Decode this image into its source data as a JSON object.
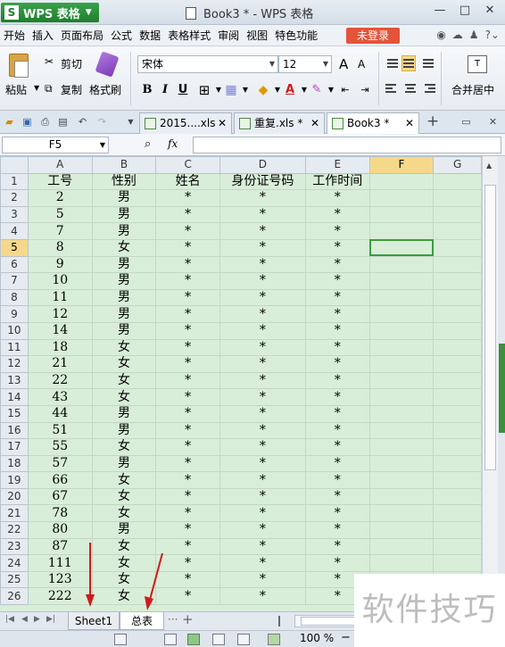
{
  "app": {
    "name": "WPS 表格",
    "window_title": "Book3 * - WPS 表格",
    "logo_letter": "S"
  },
  "window_controls": [
    "—",
    "□",
    "✕"
  ],
  "menu": {
    "items": [
      "开始",
      "插入",
      "页面布局",
      "公式",
      "数据",
      "表格样式",
      "审阅",
      "视图",
      "特色功能"
    ],
    "login_label": "未登录"
  },
  "ribbon": {
    "paste_label": "粘贴",
    "cut_label": "剪切",
    "copy_label": "复制",
    "format_painter_label": "格式刷",
    "font_name": "宋体",
    "font_size": "12",
    "bold": "B",
    "italic": "I",
    "underline": "U",
    "merge_label": "合并居中",
    "grow_font": "A",
    "shrink_font": "A"
  },
  "doc_tabs": [
    {
      "label": "2015....xls"
    },
    {
      "label": "重复.xls *"
    },
    {
      "label": "Book3 *"
    }
  ],
  "formula_bar": {
    "cell_ref": "F5",
    "fx_label": "fx",
    "value": ""
  },
  "grid": {
    "columns": [
      "A",
      "B",
      "C",
      "D",
      "E",
      "F",
      "G"
    ],
    "selected_column": "F",
    "selected_row": "5",
    "row_numbers": [
      "1",
      "2",
      "3",
      "4",
      "5",
      "6",
      "7",
      "8",
      "9",
      "10",
      "11",
      "12",
      "13",
      "14",
      "15",
      "16",
      "17",
      "18",
      "19",
      "20",
      "21",
      "22",
      "23",
      "24",
      "25",
      "26"
    ],
    "header_row": [
      "工号",
      "性别",
      "姓名",
      "身份证号码",
      "工作时间"
    ],
    "rows": [
      [
        "2",
        "男",
        "*",
        "*",
        "*"
      ],
      [
        "5",
        "男",
        "*",
        "*",
        "*"
      ],
      [
        "7",
        "男",
        "*",
        "*",
        "*"
      ],
      [
        "8",
        "女",
        "*",
        "*",
        "*"
      ],
      [
        "9",
        "男",
        "*",
        "*",
        "*"
      ],
      [
        "10",
        "男",
        "*",
        "*",
        "*"
      ],
      [
        "11",
        "男",
        "*",
        "*",
        "*"
      ],
      [
        "12",
        "男",
        "*",
        "*",
        "*"
      ],
      [
        "14",
        "男",
        "*",
        "*",
        "*"
      ],
      [
        "18",
        "女",
        "*",
        "*",
        "*"
      ],
      [
        "21",
        "女",
        "*",
        "*",
        "*"
      ],
      [
        "22",
        "女",
        "*",
        "*",
        "*"
      ],
      [
        "43",
        "女",
        "*",
        "*",
        "*"
      ],
      [
        "44",
        "男",
        "*",
        "*",
        "*"
      ],
      [
        "51",
        "男",
        "*",
        "*",
        "*"
      ],
      [
        "55",
        "女",
        "*",
        "*",
        "*"
      ],
      [
        "57",
        "男",
        "*",
        "*",
        "*"
      ],
      [
        "66",
        "女",
        "*",
        "*",
        "*"
      ],
      [
        "67",
        "女",
        "*",
        "*",
        "*"
      ],
      [
        "78",
        "女",
        "*",
        "*",
        "*"
      ],
      [
        "80",
        "男",
        "*",
        "*",
        "*"
      ],
      [
        "87",
        "女",
        "*",
        "*",
        "*"
      ],
      [
        "111",
        "女",
        "*",
        "*",
        "*"
      ],
      [
        "123",
        "女",
        "*",
        "*",
        "*"
      ],
      [
        "222",
        "女",
        "*",
        "*",
        "*"
      ]
    ]
  },
  "sheet_tabs": [
    "Sheet1",
    "总表"
  ],
  "active_sheet": "总表",
  "status": {
    "zoom": "100 %"
  },
  "watermark": "软件技巧",
  "colors": {
    "cell_fill": "#d8eed8",
    "selection": "#3d9b3d",
    "app_button": "#1f7e2d",
    "login": "#e4533a",
    "annotation_arrow": "#d11a1a"
  }
}
